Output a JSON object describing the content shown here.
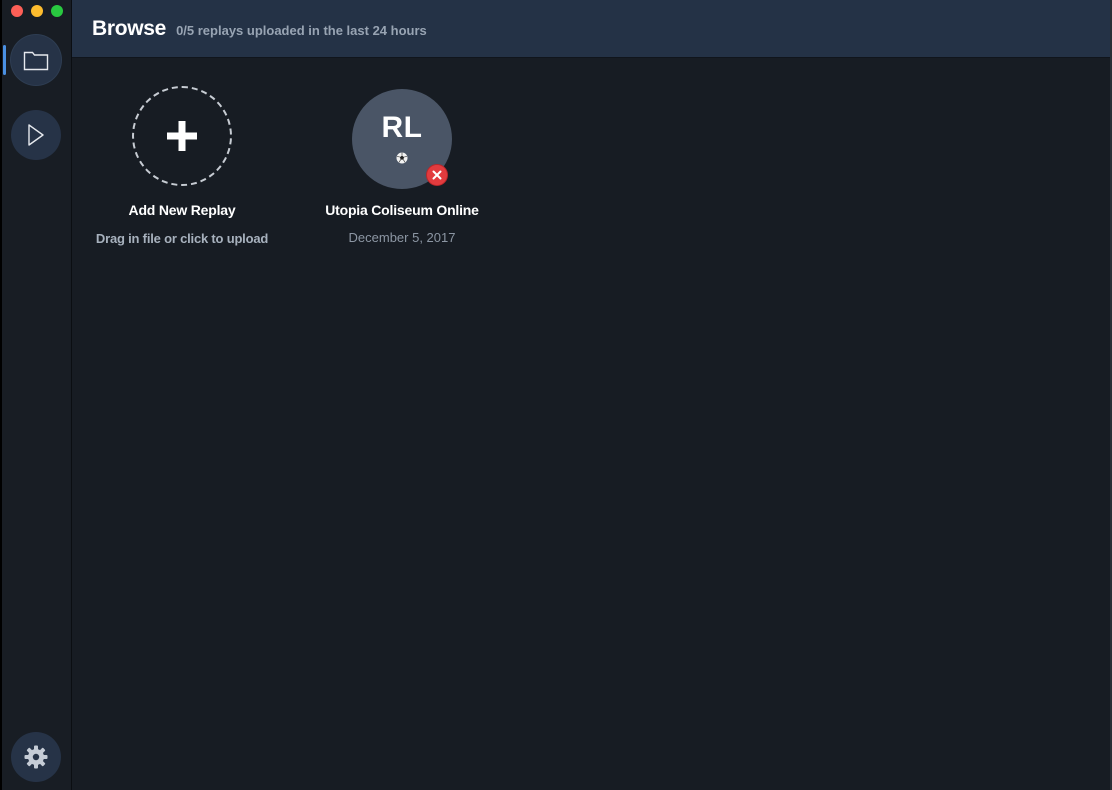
{
  "header": {
    "title": "Browse",
    "subtitle": "0/5 replays uploaded in the last 24 hours"
  },
  "sidebar": {
    "items": [
      {
        "icon": "folder-icon",
        "active": true
      },
      {
        "icon": "play-icon",
        "active": false
      },
      {
        "icon": "gear-icon",
        "active": false
      }
    ]
  },
  "add_card": {
    "icon": "plus-icon",
    "title": "Add New Replay",
    "subtitle": "Drag in file or click to upload"
  },
  "replays": [
    {
      "initials": "RL",
      "title": "Utopia Coliseum Online",
      "date": "December 5, 2017",
      "badge_icon": "soccer-ball-icon",
      "status_icon": "close-icon"
    }
  ],
  "colors": {
    "accent": "#4a90e2",
    "header_bg": "#243246",
    "content_bg": "#171c23",
    "danger": "#e23b3e"
  }
}
